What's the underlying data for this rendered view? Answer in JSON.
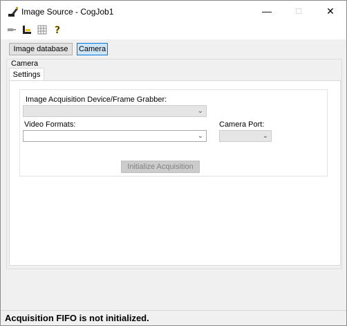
{
  "window": {
    "title": "Image Source - CogJob1",
    "minimize_glyph": "—",
    "maximize_glyph": "☐",
    "close_glyph": "✕"
  },
  "toolbar": {
    "icons": [
      "pin-icon",
      "acquisition-properties-icon",
      "grid-settings-icon",
      "help-icon"
    ],
    "help_glyph": "?"
  },
  "source_buttons": {
    "image_database_label": "Image database",
    "camera_label": "Camera"
  },
  "camera_group": {
    "label": "Camera",
    "tabs": [
      {
        "label": "Settings"
      }
    ],
    "device_label": "Image Acquisition Device/Frame Grabber:",
    "device_value": "",
    "video_formats_label": "Video Formats:",
    "video_formats_value": "",
    "camera_port_label": "Camera Port:",
    "camera_port_value": "",
    "init_button_label": "Initialize Acquisition"
  },
  "status": {
    "text": "Acquisition FIFO is not initialized."
  },
  "colors": {
    "active_button_bg": "#cce4f7",
    "active_button_border": "#0078d7",
    "disabled_bg": "#e5e5e5"
  }
}
